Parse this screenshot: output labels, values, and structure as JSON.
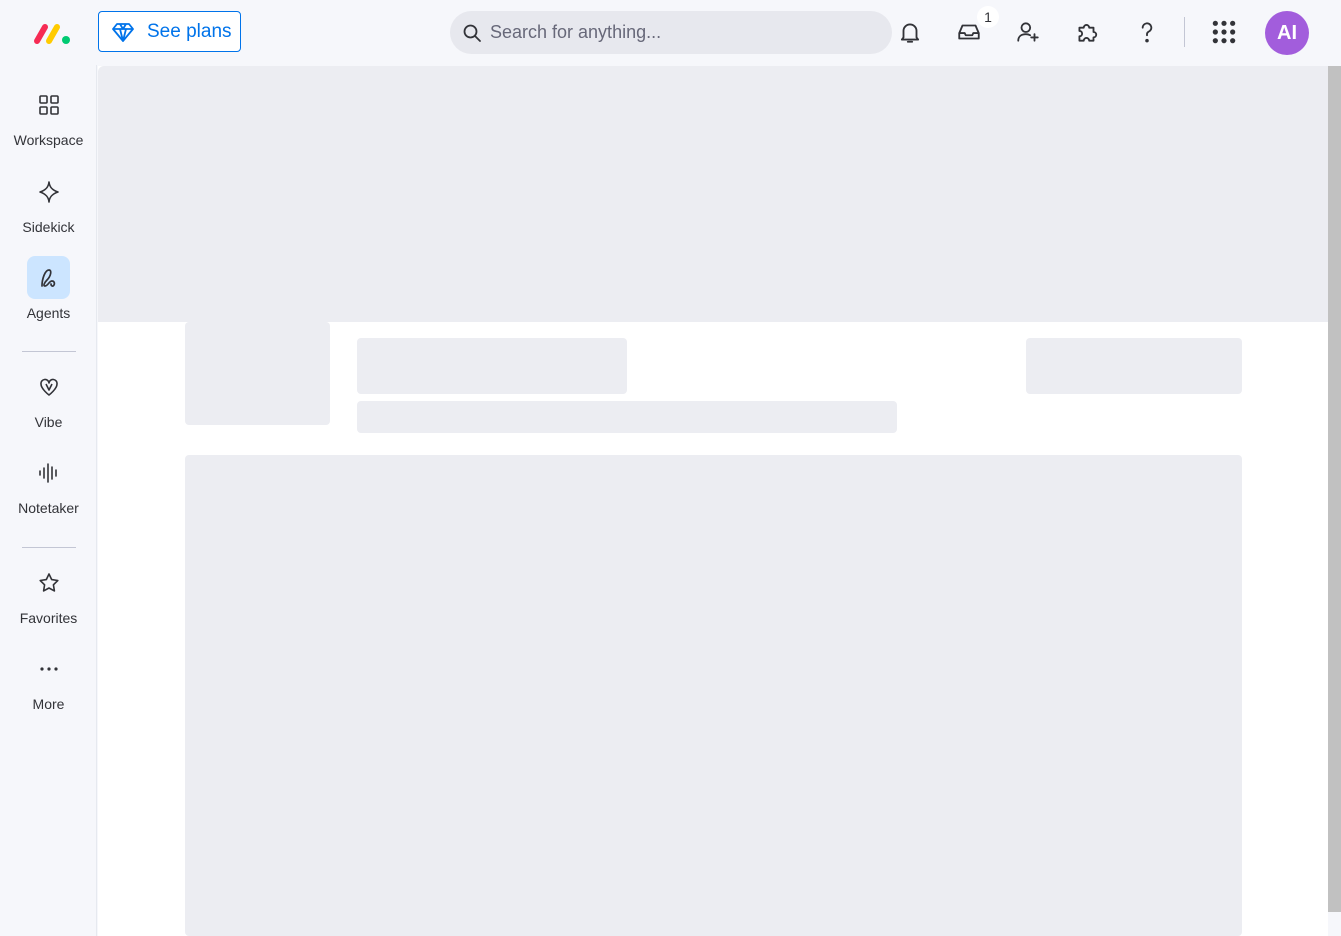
{
  "header": {
    "see_plans_label": "See plans",
    "search_placeholder": "Search for anything...",
    "inbox_badge": "1",
    "avatar_initials": "AI"
  },
  "sidebar": {
    "items": [
      {
        "label": "Workspace",
        "icon": "workspace-icon"
      },
      {
        "label": "Sidekick",
        "icon": "sparkle-icon"
      },
      {
        "label": "Agents",
        "icon": "agents-icon",
        "active": true
      },
      {
        "label": "Vibe",
        "icon": "heart-icon"
      },
      {
        "label": "Notetaker",
        "icon": "waveform-icon"
      },
      {
        "label": "Favorites",
        "icon": "star-icon"
      },
      {
        "label": "More",
        "icon": "more-icon"
      }
    ]
  },
  "colors": {
    "accent": "#0073ea",
    "avatar": "#a25ddc",
    "active_nav": "#cce5ff",
    "skeleton": "#ecedf2"
  }
}
